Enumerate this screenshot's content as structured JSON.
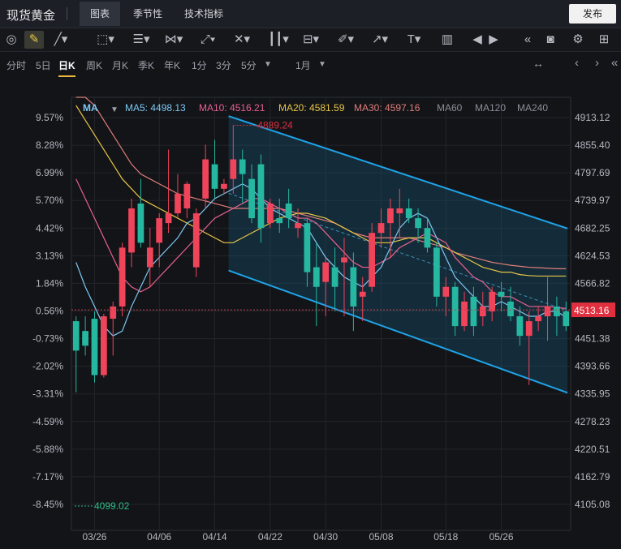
{
  "header": {
    "title": "现货黄金",
    "tabs": [
      "图表",
      "季节性",
      "技术指标"
    ],
    "active_tab": "图表",
    "publish_label": "发布"
  },
  "toolbar": {
    "icons": [
      "target-icon",
      "pencil-icon",
      "line-icon",
      "rectangle-icon",
      "lines-icon",
      "pattern-icon",
      "measure-icon",
      "fork-icon",
      "bars-icon",
      "channel-icon",
      "brush-icon",
      "arrow-icon",
      "text-icon",
      "ruler-icon",
      "prev-icon",
      "next-icon",
      "rewind-icon",
      "camera-icon",
      "settings-icon",
      "layout-icon"
    ]
  },
  "periods": {
    "items": [
      "分时",
      "5日",
      "日K",
      "周K",
      "月K",
      "季K",
      "年K",
      "1分",
      "3分",
      "5分"
    ],
    "active": "日K",
    "dropdown_arrow": "▼",
    "range": "1月",
    "range_arrow": "▼",
    "nav": [
      "↔",
      "‹",
      "›",
      "«"
    ]
  },
  "ma_legend": {
    "label": "MA",
    "items": [
      {
        "name": "MA5",
        "value": "4498.13",
        "color": "#7ec8f2"
      },
      {
        "name": "MA10",
        "value": "4516.21",
        "color": "#e9608f"
      },
      {
        "name": "MA20",
        "value": "4581.59",
        "color": "#e8c547"
      },
      {
        "name": "MA30",
        "value": "4597.16",
        "color": "#e07d7a"
      },
      {
        "name": "MA60",
        "value": "",
        "color": "#8a8e96"
      },
      {
        "name": "MA120",
        "value": "",
        "color": "#8a8e96"
      },
      {
        "name": "MA240",
        "value": "",
        "color": "#8a8e96"
      }
    ]
  },
  "chart_data": {
    "type": "candlestick",
    "x_tick_labels": [
      "03/26",
      "04/06",
      "04/14",
      "04/22",
      "04/30",
      "05/08",
      "05/18",
      "05/26"
    ],
    "y_right_ticks": [
      "4913.12",
      "4855.40",
      "4797.69",
      "4739.97",
      "4682.25",
      "4624.53",
      "4566.82",
      "4509.10",
      "4451.38",
      "4393.66",
      "4335.95",
      "4278.23",
      "4220.51",
      "4162.79",
      "4105.08"
    ],
    "y_left_ticks": [
      "9.57%",
      "8.28%",
      "6.99%",
      "5.70%",
      "4.42%",
      "3.13%",
      "1.84%",
      "0.56%",
      "-0.73%",
      "-2.02%",
      "-3.31%",
      "-4.59%",
      "-5.88%",
      "-7.17%",
      "-8.45%"
    ],
    "ylim": [
      4080,
      4930
    ],
    "current_price": "4513.16",
    "high_annotation": "4889.24",
    "low_annotation": "4099.02",
    "colors": {
      "up": "#f0445a",
      "down": "#26b7a1",
      "channel": "#1fa3e8",
      "ma5": "#7ec8f2",
      "ma10": "#e9608f",
      "ma20": "#e8c547",
      "ma30": "#e07d7a"
    },
    "candles": [
      {
        "o": 4490,
        "h": 4500,
        "l": 4345,
        "c": 4430
      },
      {
        "o": 4470,
        "h": 4500,
        "l": 4420,
        "c": 4440
      },
      {
        "o": 4495,
        "h": 4510,
        "l": 4365,
        "c": 4380
      },
      {
        "o": 4380,
        "h": 4505,
        "l": 4375,
        "c": 4500
      },
      {
        "o": 4495,
        "h": 4530,
        "l": 4420,
        "c": 4520
      },
      {
        "o": 4520,
        "h": 4650,
        "l": 4500,
        "c": 4640
      },
      {
        "o": 4630,
        "h": 4740,
        "l": 4600,
        "c": 4720
      },
      {
        "o": 4730,
        "h": 4780,
        "l": 4640,
        "c": 4650
      },
      {
        "o": 4600,
        "h": 4680,
        "l": 4560,
        "c": 4640
      },
      {
        "o": 4650,
        "h": 4710,
        "l": 4600,
        "c": 4700
      },
      {
        "o": 4690,
        "h": 4840,
        "l": 4670,
        "c": 4710
      },
      {
        "o": 4710,
        "h": 4790,
        "l": 4700,
        "c": 4750
      },
      {
        "o": 4720,
        "h": 4775,
        "l": 4700,
        "c": 4770
      },
      {
        "o": 4600,
        "h": 4720,
        "l": 4580,
        "c": 4710
      },
      {
        "o": 4740,
        "h": 4850,
        "l": 4720,
        "c": 4820
      },
      {
        "o": 4810,
        "h": 4860,
        "l": 4740,
        "c": 4760
      },
      {
        "o": 4760,
        "h": 4780,
        "l": 4750,
        "c": 4770
      },
      {
        "o": 4780,
        "h": 4889.24,
        "l": 4750,
        "c": 4820
      },
      {
        "o": 4820,
        "h": 4840,
        "l": 4730,
        "c": 4790
      },
      {
        "o": 4780,
        "h": 4810,
        "l": 4690,
        "c": 4700
      },
      {
        "o": 4810,
        "h": 4830,
        "l": 4650,
        "c": 4680
      },
      {
        "o": 4690,
        "h": 4740,
        "l": 4680,
        "c": 4730
      },
      {
        "o": 4700,
        "h": 4740,
        "l": 4670,
        "c": 4690
      },
      {
        "o": 4730,
        "h": 4760,
        "l": 4680,
        "c": 4700
      },
      {
        "o": 4680,
        "h": 4720,
        "l": 4660,
        "c": 4690
      },
      {
        "o": 4690,
        "h": 4700,
        "l": 4560,
        "c": 4590
      },
      {
        "o": 4600,
        "h": 4650,
        "l": 4480,
        "c": 4560
      },
      {
        "o": 4570,
        "h": 4620,
        "l": 4500,
        "c": 4610
      },
      {
        "o": 4600,
        "h": 4640,
        "l": 4510,
        "c": 4560
      },
      {
        "o": 4610,
        "h": 4660,
        "l": 4500,
        "c": 4620
      },
      {
        "o": 4600,
        "h": 4630,
        "l": 4470,
        "c": 4520
      },
      {
        "o": 4540,
        "h": 4580,
        "l": 4490,
        "c": 4550
      },
      {
        "o": 4560,
        "h": 4690,
        "l": 4550,
        "c": 4670
      },
      {
        "o": 4670,
        "h": 4720,
        "l": 4640,
        "c": 4690
      },
      {
        "o": 4690,
        "h": 4740,
        "l": 4620,
        "c": 4720
      },
      {
        "o": 4710,
        "h": 4760,
        "l": 4660,
        "c": 4720
      },
      {
        "o": 4720,
        "h": 4740,
        "l": 4690,
        "c": 4700
      },
      {
        "o": 4700,
        "h": 4720,
        "l": 4650,
        "c": 4680
      },
      {
        "o": 4680,
        "h": 4700,
        "l": 4630,
        "c": 4640
      },
      {
        "o": 4640,
        "h": 4650,
        "l": 4520,
        "c": 4540
      },
      {
        "o": 4540,
        "h": 4580,
        "l": 4500,
        "c": 4560
      },
      {
        "o": 4560,
        "h": 4570,
        "l": 4460,
        "c": 4480
      },
      {
        "o": 4480,
        "h": 4550,
        "l": 4470,
        "c": 4530
      },
      {
        "o": 4540,
        "h": 4560,
        "l": 4460,
        "c": 4480
      },
      {
        "o": 4500,
        "h": 4550,
        "l": 4480,
        "c": 4520
      },
      {
        "o": 4510,
        "h": 4560,
        "l": 4490,
        "c": 4550
      },
      {
        "o": 4550,
        "h": 4570,
        "l": 4510,
        "c": 4540
      },
      {
        "o": 4530,
        "h": 4560,
        "l": 4490,
        "c": 4500
      },
      {
        "o": 4500,
        "h": 4520,
        "l": 4440,
        "c": 4460
      },
      {
        "o": 4460,
        "h": 4510,
        "l": 4360,
        "c": 4490
      },
      {
        "o": 4490,
        "h": 4520,
        "l": 4470,
        "c": 4500
      },
      {
        "o": 4500,
        "h": 4580,
        "l": 4450,
        "c": 4520
      },
      {
        "o": 4520,
        "h": 4540,
        "l": 4460,
        "c": 4500
      },
      {
        "o": 4510,
        "h": 4530,
        "l": 4470,
        "c": 4480
      }
    ],
    "ma": {
      "ma5": [
        4610,
        4560,
        4520,
        4480,
        4460,
        4470,
        4520,
        4560,
        4600,
        4620,
        4640,
        4660,
        4690,
        4700,
        4720,
        4740,
        4750,
        4760,
        4770,
        4760,
        4740,
        4720,
        4710,
        4700,
        4690,
        4680,
        4650,
        4620,
        4600,
        4580,
        4570,
        4560,
        4580,
        4600,
        4640,
        4680,
        4700,
        4710,
        4700,
        4660,
        4620,
        4580,
        4560,
        4540,
        4520,
        4520,
        4530,
        4520,
        4510,
        4500,
        4500,
        4510,
        4510,
        4498
      ],
      "ma10": [
        4780,
        4740,
        4700,
        4660,
        4620,
        4580,
        4560,
        4550,
        4560,
        4580,
        4600,
        4620,
        4640,
        4660,
        4680,
        4700,
        4710,
        4720,
        4730,
        4740,
        4740,
        4730,
        4720,
        4710,
        4700,
        4700,
        4690,
        4670,
        4650,
        4630,
        4610,
        4600,
        4600,
        4610,
        4620,
        4640,
        4650,
        4660,
        4670,
        4660,
        4650,
        4620,
        4600,
        4580,
        4570,
        4550,
        4540,
        4540,
        4530,
        4520,
        4520,
        4520,
        4518,
        4516
      ],
      "ma20": [
        4930,
        4900,
        4870,
        4840,
        4810,
        4780,
        4760,
        4740,
        4730,
        4720,
        4710,
        4700,
        4690,
        4680,
        4670,
        4660,
        4650,
        4650,
        4660,
        4670,
        4680,
        4690,
        4700,
        4705,
        4710,
        4710,
        4705,
        4700,
        4690,
        4680,
        4670,
        4660,
        4650,
        4650,
        4650,
        4655,
        4660,
        4660,
        4660,
        4650,
        4640,
        4630,
        4620,
        4610,
        4600,
        4595,
        4590,
        4590,
        4585,
        4583,
        4582,
        4582,
        4582,
        4582
      ],
      "ma30": [
        4990,
        4960,
        4930,
        4900,
        4870,
        4840,
        4810,
        4790,
        4780,
        4770,
        4760,
        4750,
        4745,
        4740,
        4735,
        4730,
        4725,
        4720,
        4720,
        4720,
        4720,
        4720,
        4720,
        4715,
        4710,
        4705,
        4700,
        4695,
        4690,
        4680,
        4670,
        4665,
        4660,
        4660,
        4660,
        4660,
        4660,
        4655,
        4650,
        4645,
        4640,
        4630,
        4625,
        4620,
        4615,
        4610,
        4607,
        4604,
        4602,
        4600,
        4599,
        4598,
        4597,
        4597
      ]
    },
    "channel": {
      "upper": [
        {
          "i": 17,
          "p": 4905
        },
        {
          "i": 53,
          "p": 4680
        }
      ],
      "lower": [
        {
          "i": 17,
          "p": 4590
        },
        {
          "i": 53,
          "p": 4345
        }
      ]
    }
  }
}
